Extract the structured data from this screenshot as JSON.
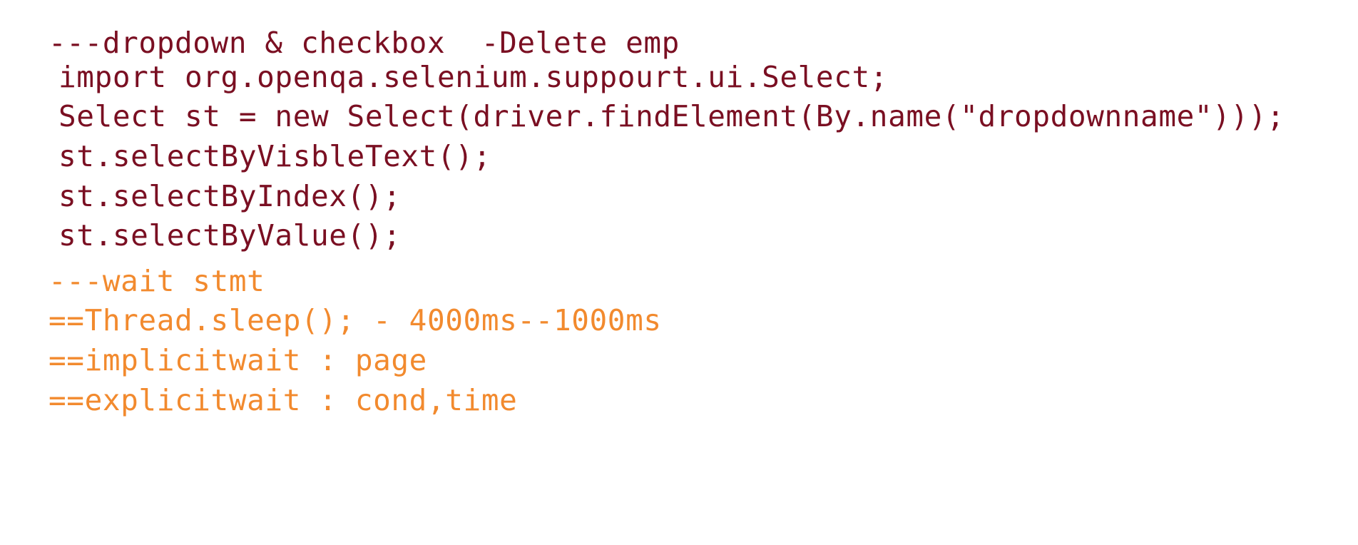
{
  "colors": {
    "code_dark_red": "#7a0f22",
    "notes_orange": "#f28a2e",
    "background": "#ffffff"
  },
  "section_dropdown": {
    "heading": "---dropdown & checkbox  -Delete emp",
    "lines": [
      "import org.openqa.selenium.suppourt.ui.Select;",
      "Select st = new Select(driver.findElement(By.name(\"dropdownname\")));",
      "st.selectByVisbleText();",
      "st.selectByIndex();",
      "st.selectByValue();"
    ]
  },
  "section_wait": {
    "heading": "---wait stmt",
    "lines": [
      "==Thread.sleep(); - 4000ms--1000ms",
      "==implicitwait : page",
      "==explicitwait : cond,time"
    ]
  }
}
